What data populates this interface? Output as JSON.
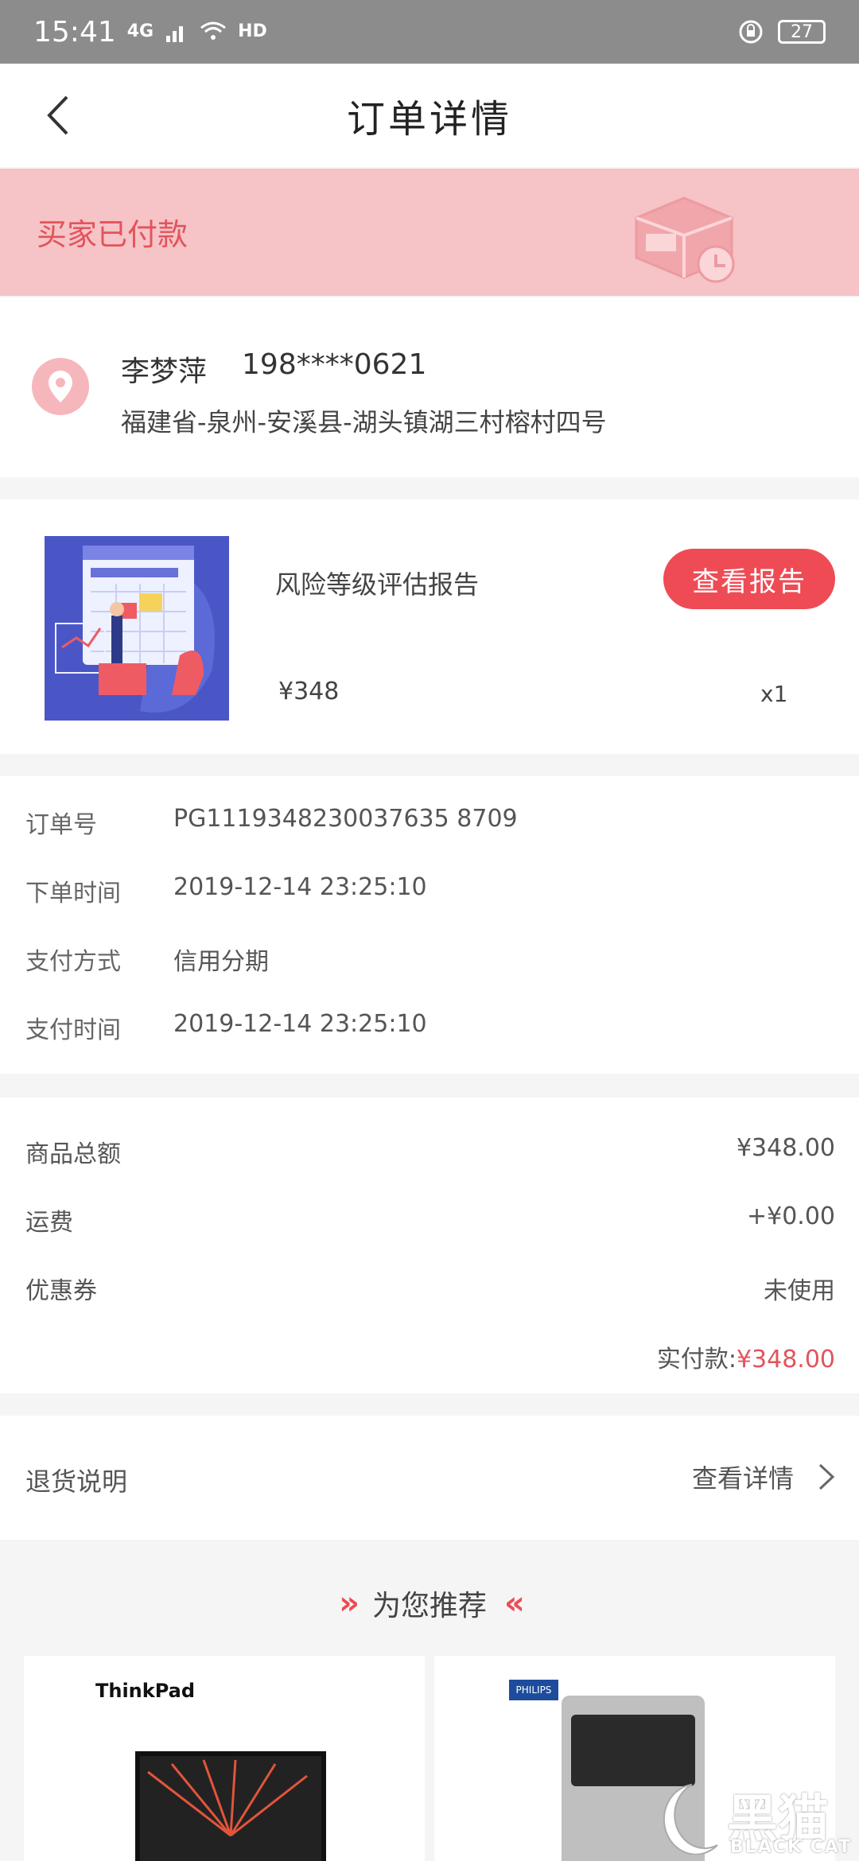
{
  "status_bar": {
    "time": "15:41",
    "signal": "4G",
    "hd": "HD",
    "battery": "27"
  },
  "nav": {
    "title": "订单详情"
  },
  "order_status": {
    "text": "买家已付款"
  },
  "address": {
    "name": "李梦萍",
    "phone": "198****0621",
    "detail": "福建省-泉州-安溪县-湖头镇湖三村榕村四号"
  },
  "product": {
    "name": "风险等级评估报告",
    "price": "¥348",
    "quantity": "x1",
    "report_button": "查看报告"
  },
  "order_info": {
    "rows": [
      {
        "label": "订单号",
        "value": "PG1119348230037635 8709"
      },
      {
        "label": "下单时间",
        "value": "2019-12-14 23:25:10"
      },
      {
        "label": "支付方式",
        "value": "信用分期"
      },
      {
        "label": "支付时间",
        "value": "2019-12-14 23:25:10"
      }
    ]
  },
  "amounts": {
    "rows": [
      {
        "label": "商品总额",
        "value": "¥348.00"
      },
      {
        "label": "运费",
        "value": "+¥0.00"
      },
      {
        "label": "优惠券",
        "value": "未使用"
      }
    ],
    "paid_label": "实付款:",
    "paid_value": "¥348.00"
  },
  "return_policy": {
    "label": "退货说明",
    "link": "查看详情"
  },
  "recommend": {
    "title": "为您推荐",
    "items": [
      {
        "brand": "ThinkPad"
      },
      {
        "brand": "PHILIPS"
      }
    ]
  },
  "watermark": {
    "cn": "黑猫",
    "en": "BLACK CAT"
  }
}
